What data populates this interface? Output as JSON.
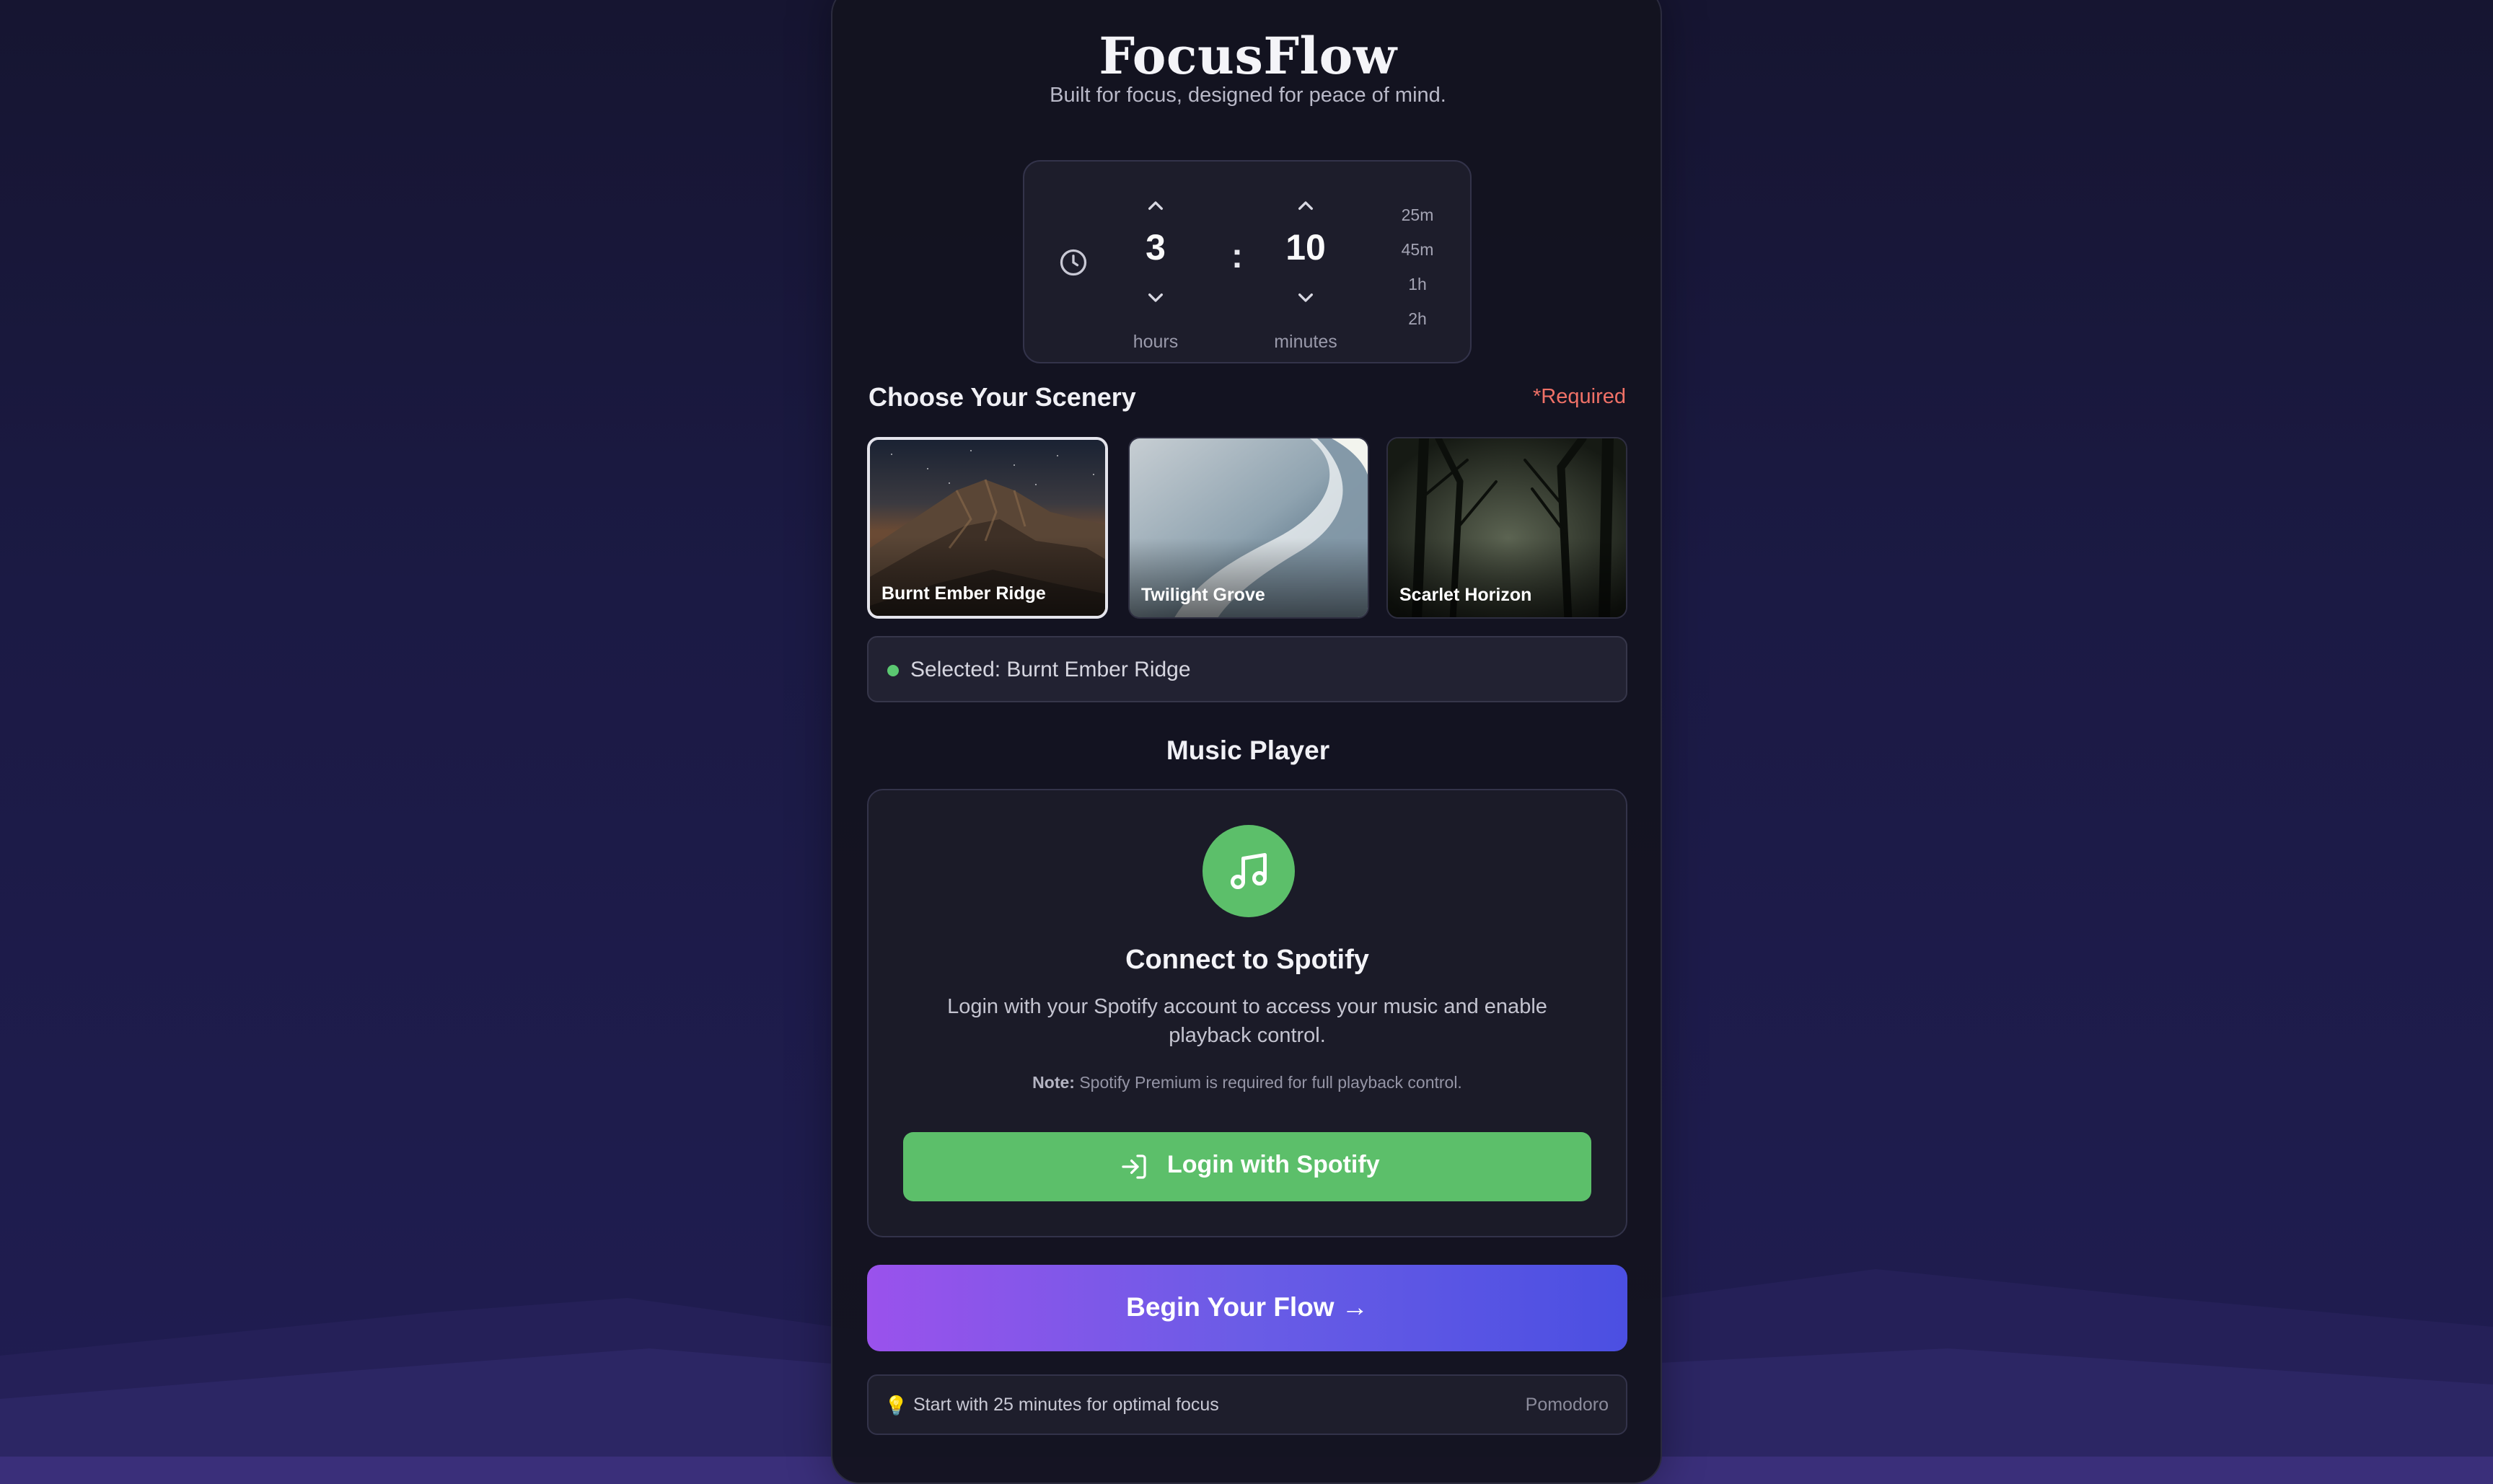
{
  "app": {
    "title": "FocusFlow",
    "subtitle": "Built for focus, designed for peace of mind."
  },
  "timer": {
    "hours_value": "3",
    "hours_label": "hours",
    "minutes_value": "10",
    "minutes_label": "minutes",
    "separator": ":",
    "presets": [
      "25m",
      "45m",
      "1h",
      "2h"
    ]
  },
  "scenery": {
    "title": "Choose Your Scenery",
    "required": "*Required",
    "options": [
      {
        "label": "Burnt Ember Ridge",
        "selected": true
      },
      {
        "label": "Twilight Grove",
        "selected": false
      },
      {
        "label": "Scarlet Horizon",
        "selected": false
      }
    ],
    "selected_text": "Selected: Burnt Ember Ridge"
  },
  "music": {
    "title": "Music Player",
    "connect_title": "Connect to Spotify",
    "connect_desc": "Login with your Spotify account to access your music and enable playback control.",
    "note_label": "Note:",
    "note_text": " Spotify Premium is required for full playback control.",
    "login_label": "Login with Spotify"
  },
  "begin": {
    "label": "Begin Your Flow →"
  },
  "tip": {
    "icon": "💡",
    "text": "Start with 25 minutes for optimal focus",
    "tag": "Pomodoro"
  },
  "colors": {
    "accent_green": "#5cbf6a",
    "required_red": "#f07167",
    "gradient_start": "#9a52ec",
    "gradient_end": "#4b4fe2"
  },
  "icons": {
    "timer": "clock-icon",
    "increment": "chevron-up-icon",
    "decrement": "chevron-down-icon",
    "music": "music-note-icon",
    "login": "login-icon",
    "tip": "lightbulb-icon"
  }
}
